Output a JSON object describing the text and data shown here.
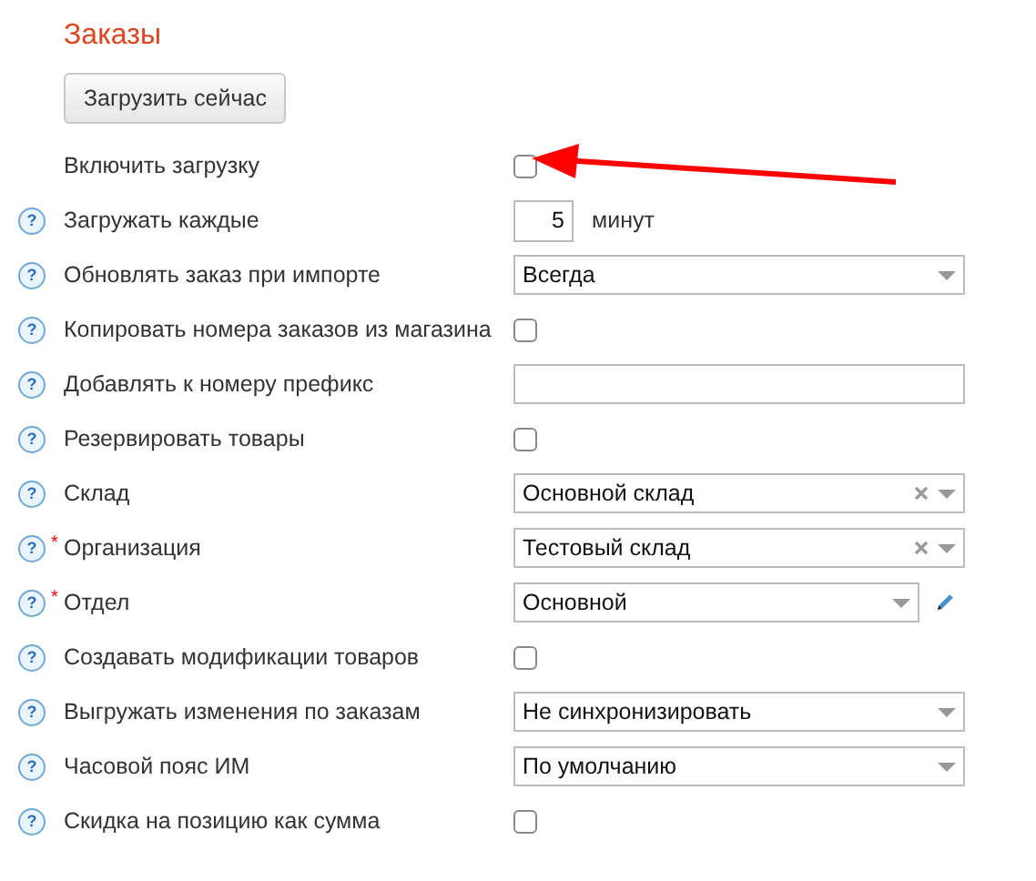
{
  "title": "Заказы",
  "load_button": "Загрузить сейчас",
  "rows": [
    {
      "kind": "checkbox",
      "label": "Включить загрузку",
      "checked": false
    },
    {
      "kind": "number",
      "label": "Загружать каждые",
      "help": "?",
      "value": "5",
      "unit": "минут"
    },
    {
      "kind": "select",
      "label": "Обновлять заказ при импорте",
      "help": "?",
      "value": "Всегда",
      "clearable": false,
      "editable": false
    },
    {
      "kind": "checkbox",
      "label": "Копировать номера заказов из магазина",
      "help": "?",
      "checked": false
    },
    {
      "kind": "text",
      "label": "Добавлять к номеру префикс",
      "help": "?"
    },
    {
      "kind": "checkbox",
      "label": "Резервировать товары",
      "help": "?",
      "checked": false
    },
    {
      "kind": "select",
      "label": "Склад",
      "help": "?",
      "value": "Основной склад",
      "clearable": true,
      "editable": false
    },
    {
      "kind": "select",
      "label": "Организация",
      "help": "?",
      "required": "*",
      "value": "Тестовый склад",
      "clearable": true,
      "editable": false
    },
    {
      "kind": "select",
      "label": "Отдел",
      "help": "?",
      "required": "*",
      "value": "Основной",
      "clearable": false,
      "editable": true
    },
    {
      "kind": "checkbox",
      "label": "Создавать модификации товаров",
      "help": "?",
      "checked": false
    },
    {
      "kind": "select",
      "label": "Выгружать изменения по заказам",
      "help": "?",
      "value": "Не синхронизировать",
      "clearable": false,
      "editable": false
    },
    {
      "kind": "select",
      "label": "Часовой пояс ИМ",
      "help": "?",
      "value": "По умолчанию",
      "clearable": false,
      "editable": false
    },
    {
      "kind": "checkbox",
      "label": "Скидка на позицию как сумма",
      "help": "?",
      "checked": false
    }
  ]
}
